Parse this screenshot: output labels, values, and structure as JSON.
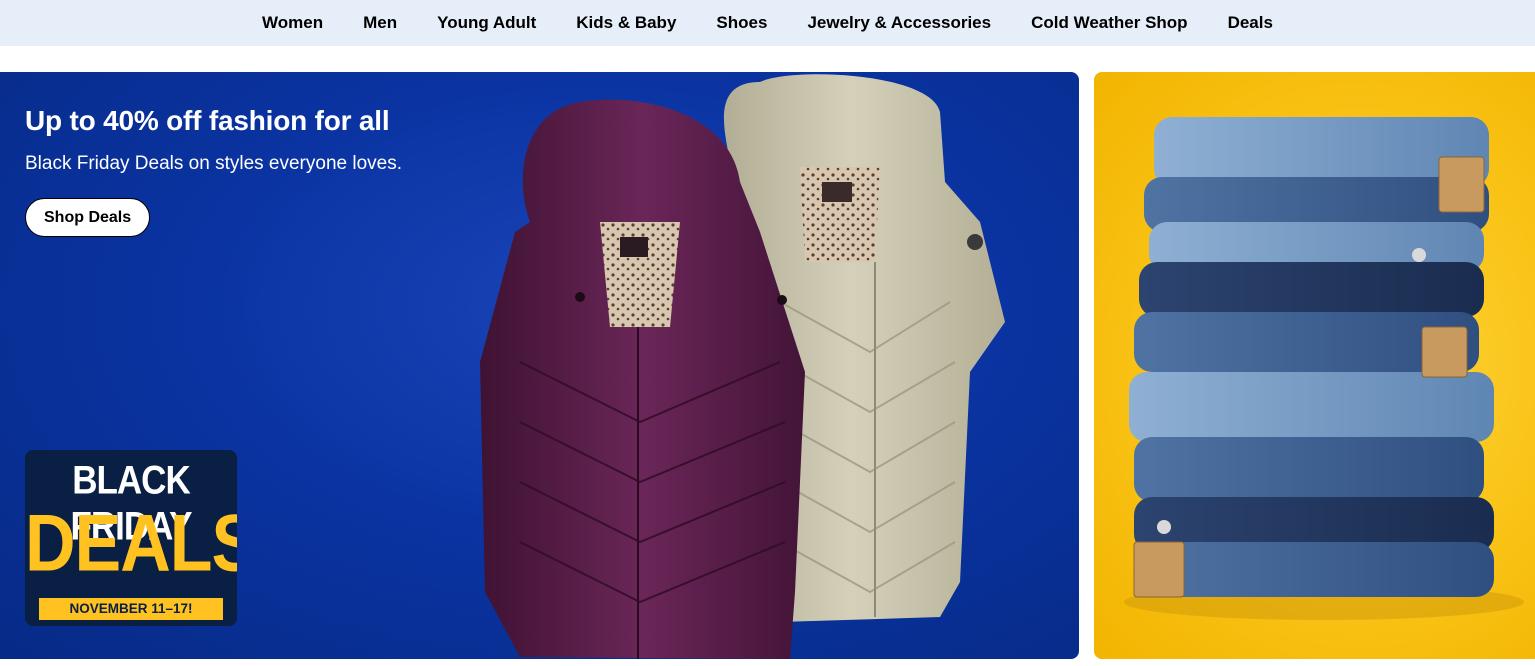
{
  "nav": {
    "items": [
      {
        "label": "Women"
      },
      {
        "label": "Men"
      },
      {
        "label": "Young Adult"
      },
      {
        "label": "Kids & Baby"
      },
      {
        "label": "Shoes"
      },
      {
        "label": "Jewelry & Accessories"
      },
      {
        "label": "Cold Weather Shop"
      },
      {
        "label": "Deals"
      }
    ]
  },
  "hero": {
    "title": "Up to 40% off fashion for all",
    "subtitle": "Black Friday Deals on styles everyone loves.",
    "cta_label": "Shop Deals",
    "badge": {
      "line1": "BLACK FRIDAY",
      "line2": "DEALS",
      "line3": "NOVEMBER 11–17!"
    },
    "colors": {
      "background": "#0b34a3",
      "coat_purple": "#5a1f4a",
      "coat_beige": "#c9c4ad"
    }
  },
  "side_card": {
    "colors": {
      "background": "#f9c316",
      "denim_dark": "#2c4a7a",
      "denim_light": "#7fa3c9"
    }
  }
}
